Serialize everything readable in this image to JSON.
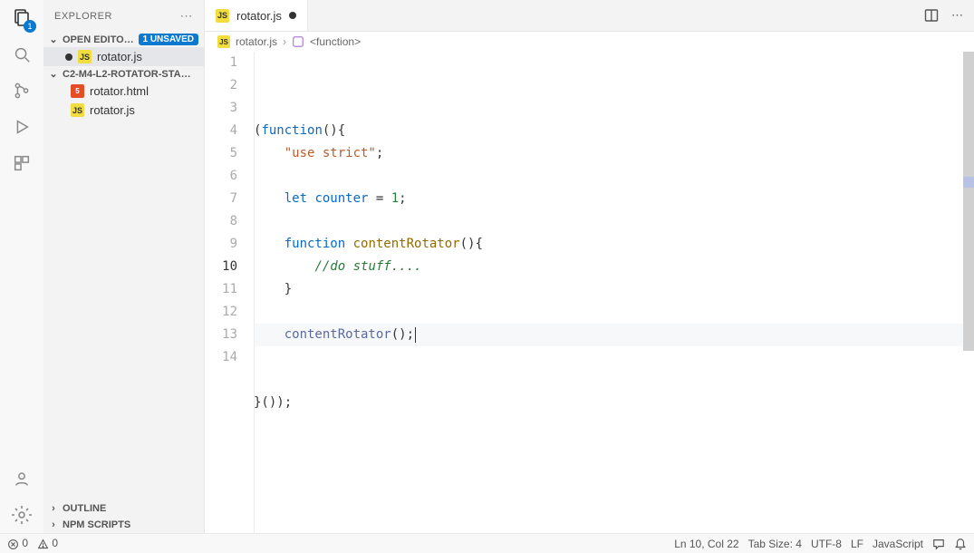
{
  "activity_bar": {
    "explorer_badge": "1"
  },
  "sidebar": {
    "title": "EXPLORER",
    "open_editors": {
      "label": "OPEN EDITO…",
      "unsaved_badge": "1 UNSAVED",
      "items": [
        {
          "name": "rotator.js",
          "icon": "JS",
          "modified": true
        }
      ]
    },
    "folder": {
      "label": "C2-M4-L2-ROTATOR-STA…",
      "items": [
        {
          "name": "rotator.html",
          "icon": "5",
          "kind": "html"
        },
        {
          "name": "rotator.js",
          "icon": "JS",
          "kind": "js"
        }
      ]
    },
    "outline": {
      "label": "OUTLINE"
    },
    "npm": {
      "label": "NPM SCRIPTS"
    }
  },
  "tabs": {
    "active": {
      "name": "rotator.js",
      "icon": "JS",
      "modified": true
    }
  },
  "breadcrumb": {
    "file": "rotator.js",
    "sep": "›",
    "symbol": "<function>"
  },
  "editor": {
    "line_count": 14,
    "active_line": 10,
    "lines": {
      "l1_a": "(",
      "l1_b": "function",
      "l1_c": "(){",
      "l2_a": "\"use strict\"",
      "l2_b": ";",
      "l4_a": "let",
      "l4_b": " counter ",
      "l4_c": "= ",
      "l4_d": "1",
      "l4_e": ";",
      "l6_a": "function",
      "l6_b": " contentRotator",
      "l6_c": "(){",
      "l7_a": "//do stuff....",
      "l8_a": "}",
      "l10_a": "contentRotator",
      "l10_b": "();",
      "l13_a": "}());"
    }
  },
  "status": {
    "errors": "0",
    "warnings": "0",
    "position": "Ln 10, Col 22",
    "tab_size": "Tab Size: 4",
    "encoding": "UTF-8",
    "eol": "LF",
    "language": "JavaScript"
  }
}
